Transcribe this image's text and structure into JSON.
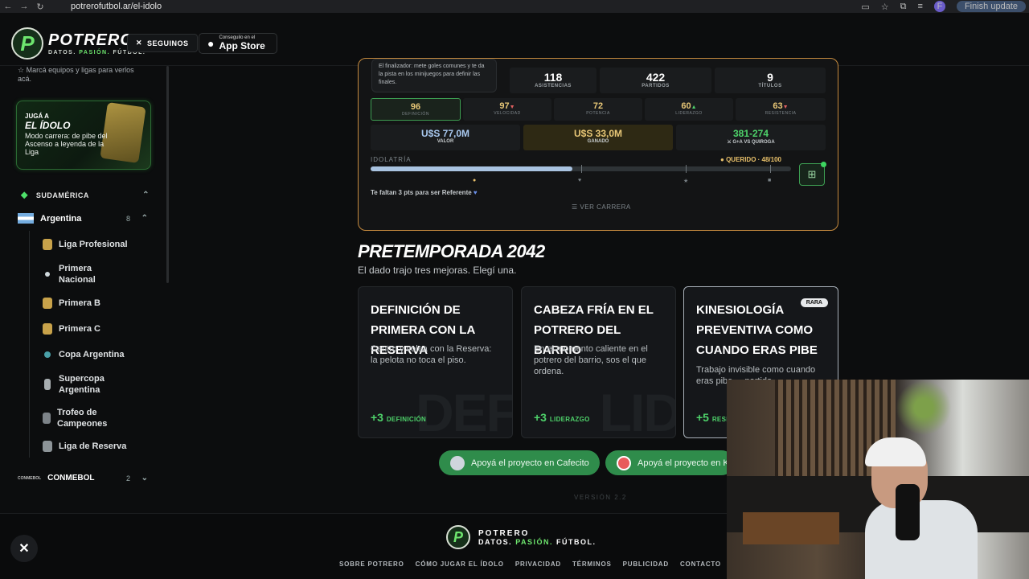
{
  "browser": {
    "url": "potrerofutbol.ar/el-idolo",
    "profile_initial": "F",
    "update_label": "Finish update"
  },
  "header": {
    "logo_letter": "P",
    "brand": "POTRERO",
    "tagline_1": "DATOS.",
    "tagline_2": "PASIÓN.",
    "tagline_3": "FÚTBOL.",
    "follow_label": "SEGUINOS",
    "store_small": "Conseguilo en el",
    "store_big": "App Store"
  },
  "sidebar": {
    "hint": "Marcá equipos y ligas para verlos acá.",
    "promo": {
      "line1": "JUGÁ A",
      "line2": "EL ÍDOLO",
      "line3": "Modo carrera: de pibe del Ascenso a leyenda de la Liga"
    },
    "region": "SUDAMÉRICA",
    "country": {
      "name": "Argentina",
      "count": "8"
    },
    "leagues": [
      "Liga Profesional",
      "Primera Nacional",
      "Primera B",
      "Primera C",
      "Copa Argentina",
      "Supercopa Argentina",
      "Trofeo de Campeones",
      "Liga de Reserva"
    ],
    "conmebol": {
      "badge": "CONMEBOL",
      "name": "CONMEBOL",
      "count": "2"
    }
  },
  "profile": {
    "tooltip": "El finalizador: mete goles comunes y te da la pista en los minijuegos para definir las finales.",
    "stats": [
      {
        "value": "118",
        "label": "ASISTENCIAS"
      },
      {
        "value": "422",
        "label": "PARTIDOS"
      },
      {
        "value": "9",
        "label": "TÍTULOS"
      }
    ],
    "attributes": [
      {
        "value": "96",
        "trend": "",
        "label": "DEFINICIÓN"
      },
      {
        "value": "97",
        "trend": "▼",
        "label": "VELOCIDAD"
      },
      {
        "value": "72",
        "trend": "",
        "label": "POTENCIA"
      },
      {
        "value": "60",
        "trend": "▲",
        "label": "LIDERAZGO"
      },
      {
        "value": "63",
        "trend": "▼",
        "label": "RESISTENCIA"
      }
    ],
    "money": [
      {
        "value": "U$S 77,0M",
        "label": "VALOR"
      },
      {
        "value": "U$S 33,0M",
        "label": "GANADO"
      },
      {
        "value": "381-274",
        "label": "G+A VS QUIROGA"
      }
    ],
    "idolatry_label": "IDOLATRÍA",
    "idolatry_status": "QUERIDO · 48/100",
    "idolatry_progress": 0.48,
    "need_text": "Te faltan 3 pts para ser Referente",
    "career_label": "VER CARRERA"
  },
  "preseason": {
    "title": "PRETEMPORADA 2042",
    "subtitle": "El dado trajo tres mejoras. Elegí una.",
    "options": [
      {
        "title": "Definición de primera con la Reserva",
        "desc": "Centro y volea con la Reserva: la pelota no toca el piso.",
        "bonus": "+3",
        "attr": "DEFINICIÓN",
        "ghost": "DEF"
      },
      {
        "title": "Cabeza fría en el potrero del barrio",
        "desc": "En el momento caliente en el potrero del barrio, sos el que ordena.",
        "bonus": "+3",
        "attr": "LIDERAZGO",
        "ghost": "LID"
      },
      {
        "title": "Kinesiología preventiva como cuando eras pibe",
        "desc": "Trabajo invisible como cuando eras pibe ... partido",
        "bonus": "+5",
        "attr": "RESIS",
        "ghost": "",
        "tag": "RARA"
      }
    ]
  },
  "support": [
    {
      "label": "Apoyá el proyecto en Cafecito"
    },
    {
      "label": "Apoyá el proyecto en K"
    }
  ],
  "version": "VERSIÓN 2.2",
  "footer": {
    "brand": "POTRERO",
    "tagline_1": "DATOS.",
    "tagline_2": "PASIÓN.",
    "tagline_3": "FÚTBOL.",
    "links": [
      "SOBRE POTRERO",
      "CÓMO JUGAR EL ÍDOLO",
      "PRIVACIDAD",
      "TÉRMINOS",
      "PUBLICIDAD",
      "CONTACTO"
    ]
  },
  "colors": {
    "accent_green": "#4ed26a",
    "card_border": "#c58a3e",
    "support_green": "#2f8c4b"
  }
}
